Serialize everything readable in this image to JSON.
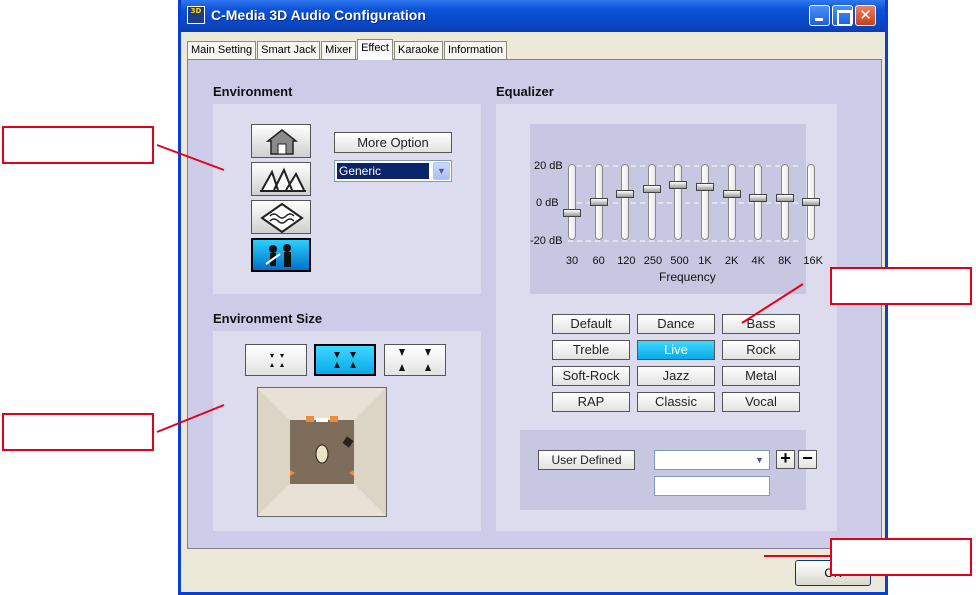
{
  "window": {
    "icon_text": "3D",
    "title": "C-Media 3D Audio Configuration",
    "controls": [
      "minimize",
      "maximize",
      "close"
    ],
    "close_glyph": "✕"
  },
  "tabs": [
    {
      "label": "Main Setting",
      "active": false
    },
    {
      "label": "Smart Jack",
      "active": false
    },
    {
      "label": "Mixer",
      "active": false
    },
    {
      "label": "Effect",
      "active": true
    },
    {
      "label": "Karaoke",
      "active": false
    },
    {
      "label": "Information",
      "active": false
    }
  ],
  "environment": {
    "title": "Environment",
    "icons": [
      "house-icon",
      "opera-house-icon",
      "water-icon",
      "live-concert-icon"
    ],
    "active_icon": "live-concert-icon",
    "more_option_label": "More Option",
    "selected_environment": "Generic"
  },
  "environment_size": {
    "title": "Environment Size",
    "options": [
      "small-size-icon",
      "medium-size-icon",
      "large-size-icon"
    ],
    "active_option": "medium-size-icon"
  },
  "equalizer": {
    "title": "Equalizer",
    "db_labels": {
      "top": "20 dB",
      "mid": "0 dB",
      "bottom": "-20 dB"
    },
    "frequencies": [
      "30",
      "60",
      "120",
      "250",
      "500",
      "1K",
      "2K",
      "4K",
      "8K",
      "16K"
    ],
    "levels_db": [
      -6,
      0,
      4,
      7,
      9,
      8,
      4,
      2,
      2,
      0
    ],
    "frequency_label": "Frequency",
    "presets": [
      "Default",
      "Dance",
      "Bass",
      "Treble",
      "Live",
      "Rock",
      "Soft-Rock",
      "Jazz",
      "Metal",
      "RAP",
      "Classic",
      "Vocal"
    ],
    "active_preset": "Live",
    "user_defined_label": "User Defined",
    "user_combo_value": "",
    "user_text_value": "",
    "add_label": "+",
    "remove_label": "−"
  },
  "footer": {
    "ok_label": "OK"
  },
  "colors": {
    "callout_border": "#e3001b",
    "active_button": "#09a9ea",
    "titlebar": "#0a48c8"
  }
}
